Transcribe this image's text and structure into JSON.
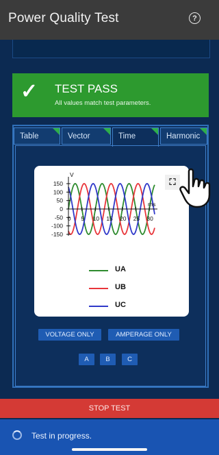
{
  "header": {
    "title": "Power Quality Test",
    "help_icon": "?"
  },
  "banner": {
    "icon": "✓",
    "title": "TEST PASS",
    "subtitle": "All values match test parameters."
  },
  "tabs": [
    {
      "label": "Table",
      "active": false
    },
    {
      "label": "Vector",
      "active": false
    },
    {
      "label": "Time",
      "active": true
    },
    {
      "label": "Harmonic",
      "active": false
    }
  ],
  "chart_data": {
    "type": "line",
    "ylabel": "V",
    "xlabel": "ms",
    "xlim": [
      0,
      32
    ],
    "ylim": [
      -150,
      150
    ],
    "yticks": [
      150,
      100,
      50,
      0,
      -50,
      -100,
      -150
    ],
    "xticks": [
      0,
      5,
      10,
      15,
      20,
      25,
      30
    ],
    "series": [
      {
        "name": "UA",
        "color": "#2e8b2e",
        "amplitude": 150,
        "period_ms": 10,
        "phase_deg": 0
      },
      {
        "name": "UB",
        "color": "#e8353a",
        "amplitude": 150,
        "period_ms": 10,
        "phase_deg": -120
      },
      {
        "name": "UC",
        "color": "#2f38c9",
        "amplitude": 150,
        "period_ms": 10,
        "phase_deg": 120
      }
    ]
  },
  "expand_icon": "⛶",
  "mode_buttons": {
    "voltage": "VOLTAGE ONLY",
    "amperage": "AMPERAGE ONLY"
  },
  "phase_buttons": [
    "A",
    "B",
    "C"
  ],
  "stop_label": "STOP TEST",
  "status_text": "Test in progress."
}
